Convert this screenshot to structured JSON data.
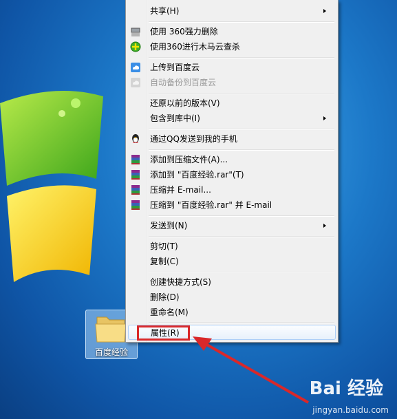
{
  "desktop": {
    "folder_label": "百度经验"
  },
  "menu": {
    "items": [
      {
        "label": "共享(H)",
        "icon": "share-icon",
        "submenu": true
      },
      {
        "label": "使用 360强力删除",
        "icon": "shredder-icon"
      },
      {
        "label": "使用360进行木马云查杀",
        "icon": "360-scan-icon"
      },
      {
        "label": "上传到百度云",
        "icon": "baidu-cloud-icon"
      },
      {
        "label": "自动备份到百度云",
        "icon": "baidu-cloud-backup-icon",
        "disabled": true
      },
      {
        "label": "还原以前的版本(V)"
      },
      {
        "label": "包含到库中(I)",
        "submenu": true
      },
      {
        "label": "通过QQ发送到我的手机",
        "icon": "qq-penguin-icon"
      },
      {
        "label": "添加到压缩文件(A)...",
        "icon": "winrar-icon"
      },
      {
        "label": "添加到 \"百度经验.rar\"(T)",
        "icon": "winrar-icon"
      },
      {
        "label": "压缩并 E-mail...",
        "icon": "winrar-icon"
      },
      {
        "label": "压缩到 \"百度经验.rar\" 并 E-mail",
        "icon": "winrar-icon"
      },
      {
        "label": "发送到(N)",
        "submenu": true
      },
      {
        "label": "剪切(T)"
      },
      {
        "label": "复制(C)"
      },
      {
        "label": "创建快捷方式(S)"
      },
      {
        "label": "删除(D)"
      },
      {
        "label": "重命名(M)"
      },
      {
        "label": "属性(R)",
        "highlighted": true
      }
    ]
  },
  "watermark": {
    "brand": "Bai 经验",
    "url": "jingyan.baidu.com"
  },
  "colors": {
    "menu_bg": "#f0f0f0",
    "annotation_red": "#d9282a",
    "desktop_blue": "#1c78c8"
  }
}
